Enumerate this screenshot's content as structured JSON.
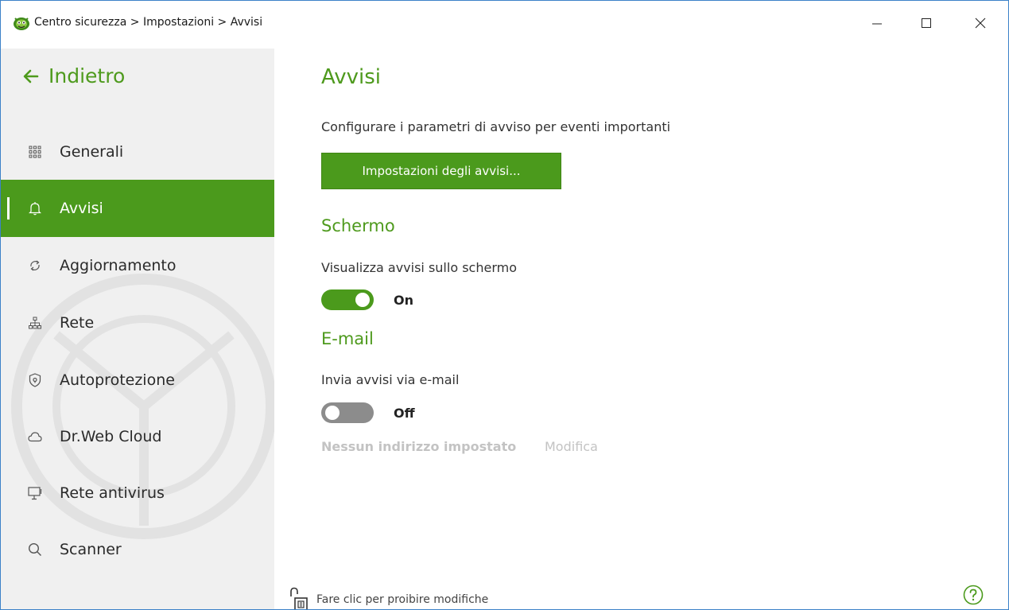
{
  "titlebar": {
    "breadcrumb": "Centro sicurezza > Impostazioni > Avvisi",
    "minimize_icon": "minimize-icon",
    "maximize_icon": "maximize-icon",
    "close_icon": "close-icon"
  },
  "sidebar": {
    "back_label": "Indietro",
    "items": [
      {
        "label": "Generali",
        "icon": "grid-icon",
        "active": false
      },
      {
        "label": "Avvisi",
        "icon": "bell-icon",
        "active": true
      },
      {
        "label": "Aggiornamento",
        "icon": "refresh-icon",
        "active": false
      },
      {
        "label": "Rete",
        "icon": "network-icon",
        "active": false
      },
      {
        "label": "Autoprotezione",
        "icon": "shield-icon",
        "active": false
      },
      {
        "label": "Dr.Web Cloud",
        "icon": "cloud-icon",
        "active": false
      },
      {
        "label": "Rete antivirus",
        "icon": "monitor-icon",
        "active": false
      },
      {
        "label": "Scanner",
        "icon": "search-icon",
        "active": false
      }
    ]
  },
  "main": {
    "title": "Avvisi",
    "description": "Configurare i parametri di avviso per eventi importanti",
    "settings_button": "Impostazioni degli avvisi...",
    "screen_section": {
      "title": "Schermo",
      "label": "Visualizza avvisi sullo schermo",
      "toggle_state": "On",
      "enabled": true
    },
    "email_section": {
      "title": "E-mail",
      "label": "Invia avvisi via e-mail",
      "toggle_state": "Off",
      "enabled": false,
      "address_status": "Nessun indirizzo impostato",
      "edit_link": "Modifica"
    },
    "lock_label": "Fare clic per proibire modifiche"
  },
  "colors": {
    "accent": "#4b9a1c",
    "accent_text": "#4e9a1d",
    "sidebar_bg": "#f0f0f0",
    "toggle_off": "#8c8c8c",
    "disabled_text": "#c3c3c3"
  }
}
